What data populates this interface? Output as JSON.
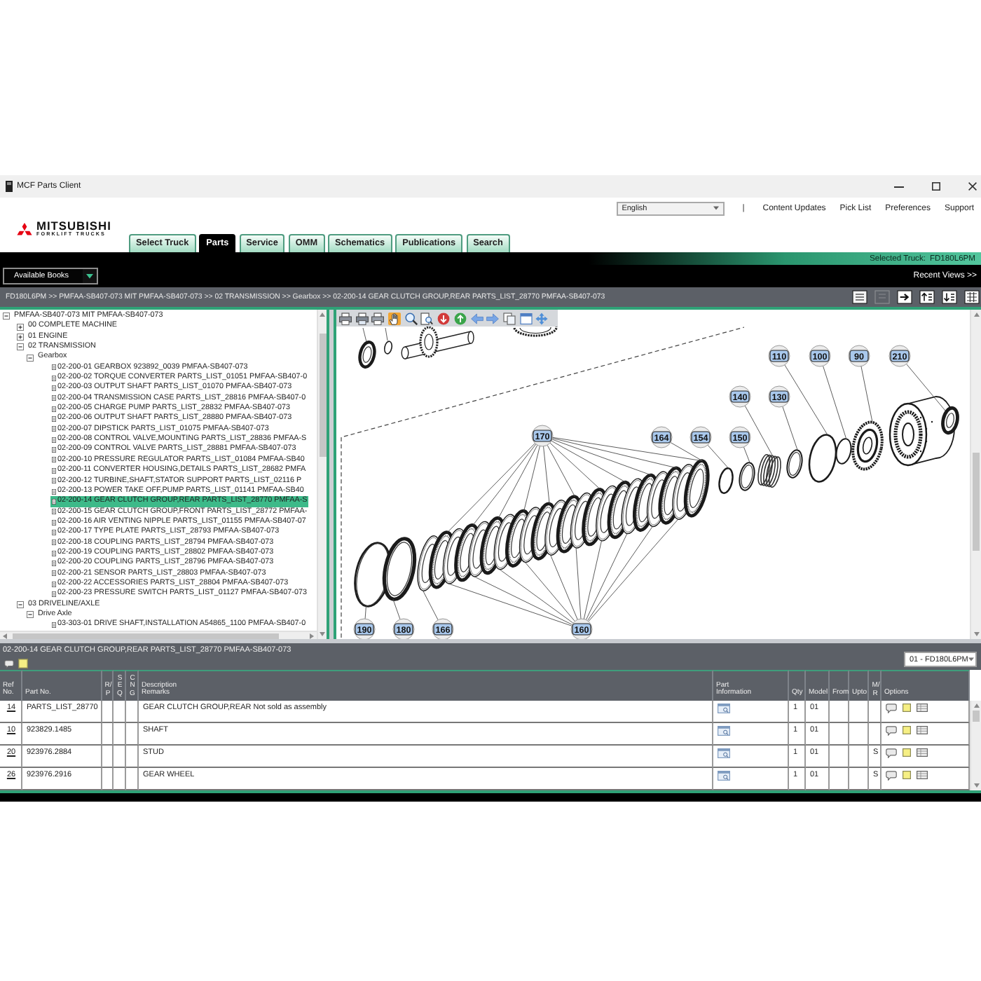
{
  "window": {
    "title": "MCF Parts Client"
  },
  "header": {
    "language": "English",
    "separator": "|",
    "links": [
      "Content Updates",
      "Pick List",
      "Preferences",
      "Support"
    ]
  },
  "logo": {
    "name": "MITSUBISHI",
    "subtitle": "FORKLIFT TRUCKS"
  },
  "tabs": [
    {
      "label": "Select Truck",
      "selected": false
    },
    {
      "label": "Parts",
      "selected": true
    },
    {
      "label": "Service",
      "selected": false
    },
    {
      "label": "OMM",
      "selected": false
    },
    {
      "label": "Schematics",
      "selected": false
    },
    {
      "label": "Publications",
      "selected": false
    },
    {
      "label": "Search",
      "selected": false
    }
  ],
  "selected_truck": {
    "label": "Selected Truck:",
    "value": "FD180L6PM"
  },
  "books": {
    "label": "Available Books"
  },
  "recent_views": "Recent Views >>",
  "breadcrumb": {
    "path": "FD180L6PM >> PMFAA-SB407-073 MIT PMFAA-SB407-073 >> 02 TRANSMISSION >> Gearbox >> 02-200-14 GEAR CLUTCH GROUP,REAR PARTS_LIST_28770 PMFAA-SB407-073",
    "buttons": [
      {
        "disabled": false
      },
      {
        "disabled": true
      },
      {
        "disabled": false
      },
      {
        "disabled": false
      },
      {
        "disabled": false
      },
      {
        "disabled": false
      }
    ]
  },
  "tree": {
    "items": [
      {
        "label": "PMFAA-SB407-073 MIT PMFAA-SB407-073",
        "kind": "folder",
        "expanded": true,
        "selected": false,
        "children": [
          {
            "label": "00 COMPLETE MACHINE",
            "kind": "folder",
            "expanded": false,
            "selected": false
          },
          {
            "label": "01 ENGINE",
            "kind": "folder",
            "expanded": false,
            "selected": false
          },
          {
            "label": "02 TRANSMISSION",
            "kind": "folder",
            "expanded": true,
            "selected": false,
            "children": [
              {
                "label": "Gearbox",
                "kind": "folder",
                "expanded": true,
                "selected": false,
                "children": [
                  {
                    "label": "02-200-01 GEARBOX 923892_0039 PMFAA-SB407-073",
                    "kind": "page",
                    "selected": false
                  },
                  {
                    "label": "02-200-02 TORQUE CONVERTER PARTS_LIST_01051 PMFAA-SB407-0",
                    "kind": "page",
                    "selected": false
                  },
                  {
                    "label": "02-200-03 OUTPUT SHAFT PARTS_LIST_01070 PMFAA-SB407-073",
                    "kind": "page",
                    "selected": false
                  },
                  {
                    "label": "02-200-04 TRANSMISSION CASE PARTS_LIST_28816 PMFAA-SB407-0",
                    "kind": "page",
                    "selected": false
                  },
                  {
                    "label": "02-200-05 CHARGE PUMP PARTS_LIST_28832 PMFAA-SB407-073",
                    "kind": "page",
                    "selected": false
                  },
                  {
                    "label": "02-200-06 OUTPUT SHAFT PARTS_LIST_28880 PMFAA-SB407-073",
                    "kind": "page",
                    "selected": false
                  },
                  {
                    "label": "02-200-07 DIPSTICK PARTS_LIST_01075 PMFAA-SB407-073",
                    "kind": "page",
                    "selected": false
                  },
                  {
                    "label": "02-200-08 CONTROL VALVE,MOUNTING PARTS_LIST_28836 PMFAA-S",
                    "kind": "page",
                    "selected": false
                  },
                  {
                    "label": "02-200-09 CONTROL VALVE PARTS_LIST_28881 PMFAA-SB407-073",
                    "kind": "page",
                    "selected": false
                  },
                  {
                    "label": "02-200-10 PRESSURE REGULATOR PARTS_LIST_01084 PMFAA-SB40",
                    "kind": "page",
                    "selected": false
                  },
                  {
                    "label": "02-200-11 CONVERTER HOUSING,DETAILS PARTS_LIST_28682 PMFA",
                    "kind": "page",
                    "selected": false
                  },
                  {
                    "label": "02-200-12 TURBINE,SHAFT,STATOR SUPPORT PARTS_LIST_02116 P",
                    "kind": "page",
                    "selected": false
                  },
                  {
                    "label": "02-200-13 POWER TAKE OFF,PUMP PARTS_LIST_01141 PMFAA-SB40",
                    "kind": "page",
                    "selected": false
                  },
                  {
                    "label": "02-200-14 GEAR CLUTCH GROUP,REAR PARTS_LIST_28770 PMFAA-S",
                    "kind": "page",
                    "selected": true
                  },
                  {
                    "label": "02-200-15 GEAR CLUTCH GROUP,FRONT PARTS_LIST_28772 PMFAA-",
                    "kind": "page",
                    "selected": false
                  },
                  {
                    "label": "02-200-16 AIR VENTING NIPPLE PARTS_LIST_01155 PMFAA-SB407-07",
                    "kind": "page",
                    "selected": false
                  },
                  {
                    "label": "02-200-17 TYPE PLATE PARTS_LIST_28793 PMFAA-SB407-073",
                    "kind": "page",
                    "selected": false
                  },
                  {
                    "label": "02-200-18 COUPLING PARTS_LIST_28794 PMFAA-SB407-073",
                    "kind": "page",
                    "selected": false
                  },
                  {
                    "label": "02-200-19 COUPLING PARTS_LIST_28802 PMFAA-SB407-073",
                    "kind": "page",
                    "selected": false
                  },
                  {
                    "label": "02-200-20 COUPLING PARTS_LIST_28796 PMFAA-SB407-073",
                    "kind": "page",
                    "selected": false
                  },
                  {
                    "label": "02-200-21 SENSOR PARTS_LIST_28803 PMFAA-SB407-073",
                    "kind": "page",
                    "selected": false
                  },
                  {
                    "label": "02-200-22 ACCESSORIES PARTS_LIST_28804 PMFAA-SB407-073",
                    "kind": "page",
                    "selected": false
                  },
                  {
                    "label": "02-200-23 PRESSURE SWITCH PARTS_LIST_01127 PMFAA-SB407-073",
                    "kind": "page",
                    "selected": false
                  }
                ]
              }
            ]
          },
          {
            "label": "03 DRIVELINE/AXLE",
            "kind": "folder",
            "expanded": true,
            "selected": false,
            "children": [
              {
                "label": "Drive Axle",
                "kind": "folder",
                "expanded": true,
                "selected": false,
                "children": [
                  {
                    "label": "03-303-01 DRIVE SHAFT,INSTALLATION A54865_1100 PMFAA-SB407-0",
                    "kind": "page",
                    "selected": false
                  }
                ]
              }
            ]
          }
        ]
      }
    ]
  },
  "diagram": {
    "tools": [
      {
        "selected": false
      },
      {
        "selected": false
      },
      {
        "selected": false
      },
      {
        "selected": true
      },
      {
        "selected": false
      },
      {
        "selected": false
      },
      {
        "selected": false
      },
      {
        "selected": false
      },
      {
        "selected": false
      },
      {
        "selected": false
      },
      {
        "selected": false
      },
      {
        "selected": false
      },
      {
        "selected": false
      }
    ],
    "callouts": [
      "110",
      "100",
      "90",
      "210",
      "140",
      "130",
      "170",
      "164",
      "154",
      "150",
      "190",
      "180",
      "166",
      "160"
    ]
  },
  "parts_list": {
    "title": "02-200-14 GEAR CLUTCH GROUP,REAR PARTS_LIST_28770 PMFAA-SB407-073",
    "model": "01 - FD180L6PM",
    "columns": [
      {
        "label": "Ref\nNo.",
        "kind": "text"
      },
      {
        "label": "Part No.",
        "kind": "text"
      },
      {
        "label": "R/P",
        "kind": "stacked"
      },
      {
        "label": "SEQ",
        "kind": "stacked"
      },
      {
        "label": "CNG",
        "kind": "stacked"
      },
      {
        "label": "Description\nRemarks",
        "kind": "text"
      },
      {
        "label": "Part\nInformation",
        "kind": "text"
      },
      {
        "label": "Qty",
        "kind": "text"
      },
      {
        "label": "Model",
        "kind": "text"
      },
      {
        "label": "From",
        "kind": "text"
      },
      {
        "label": "Upto",
        "kind": "text"
      },
      {
        "label": "M/R",
        "kind": "stacked"
      },
      {
        "label": "Options",
        "kind": "text"
      }
    ],
    "rows": [
      {
        "ref": "14",
        "part_no": "PARTS_LIST_28770",
        "description": "GEAR CLUTCH GROUP,REAR Not sold as assembly",
        "qty": "1",
        "model": "01"
      },
      {
        "ref": "10",
        "part_no": "923829.1485",
        "description": "SHAFT",
        "qty": "1",
        "model": "01"
      },
      {
        "ref": "20",
        "part_no": "923976.2884",
        "description": "STUD",
        "qty": "1",
        "model": "01",
        "mr": "S"
      },
      {
        "ref": "26",
        "part_no": "923976.2916",
        "description": "GEAR WHEEL",
        "qty": "1",
        "model": "01",
        "mr": "S"
      }
    ]
  }
}
